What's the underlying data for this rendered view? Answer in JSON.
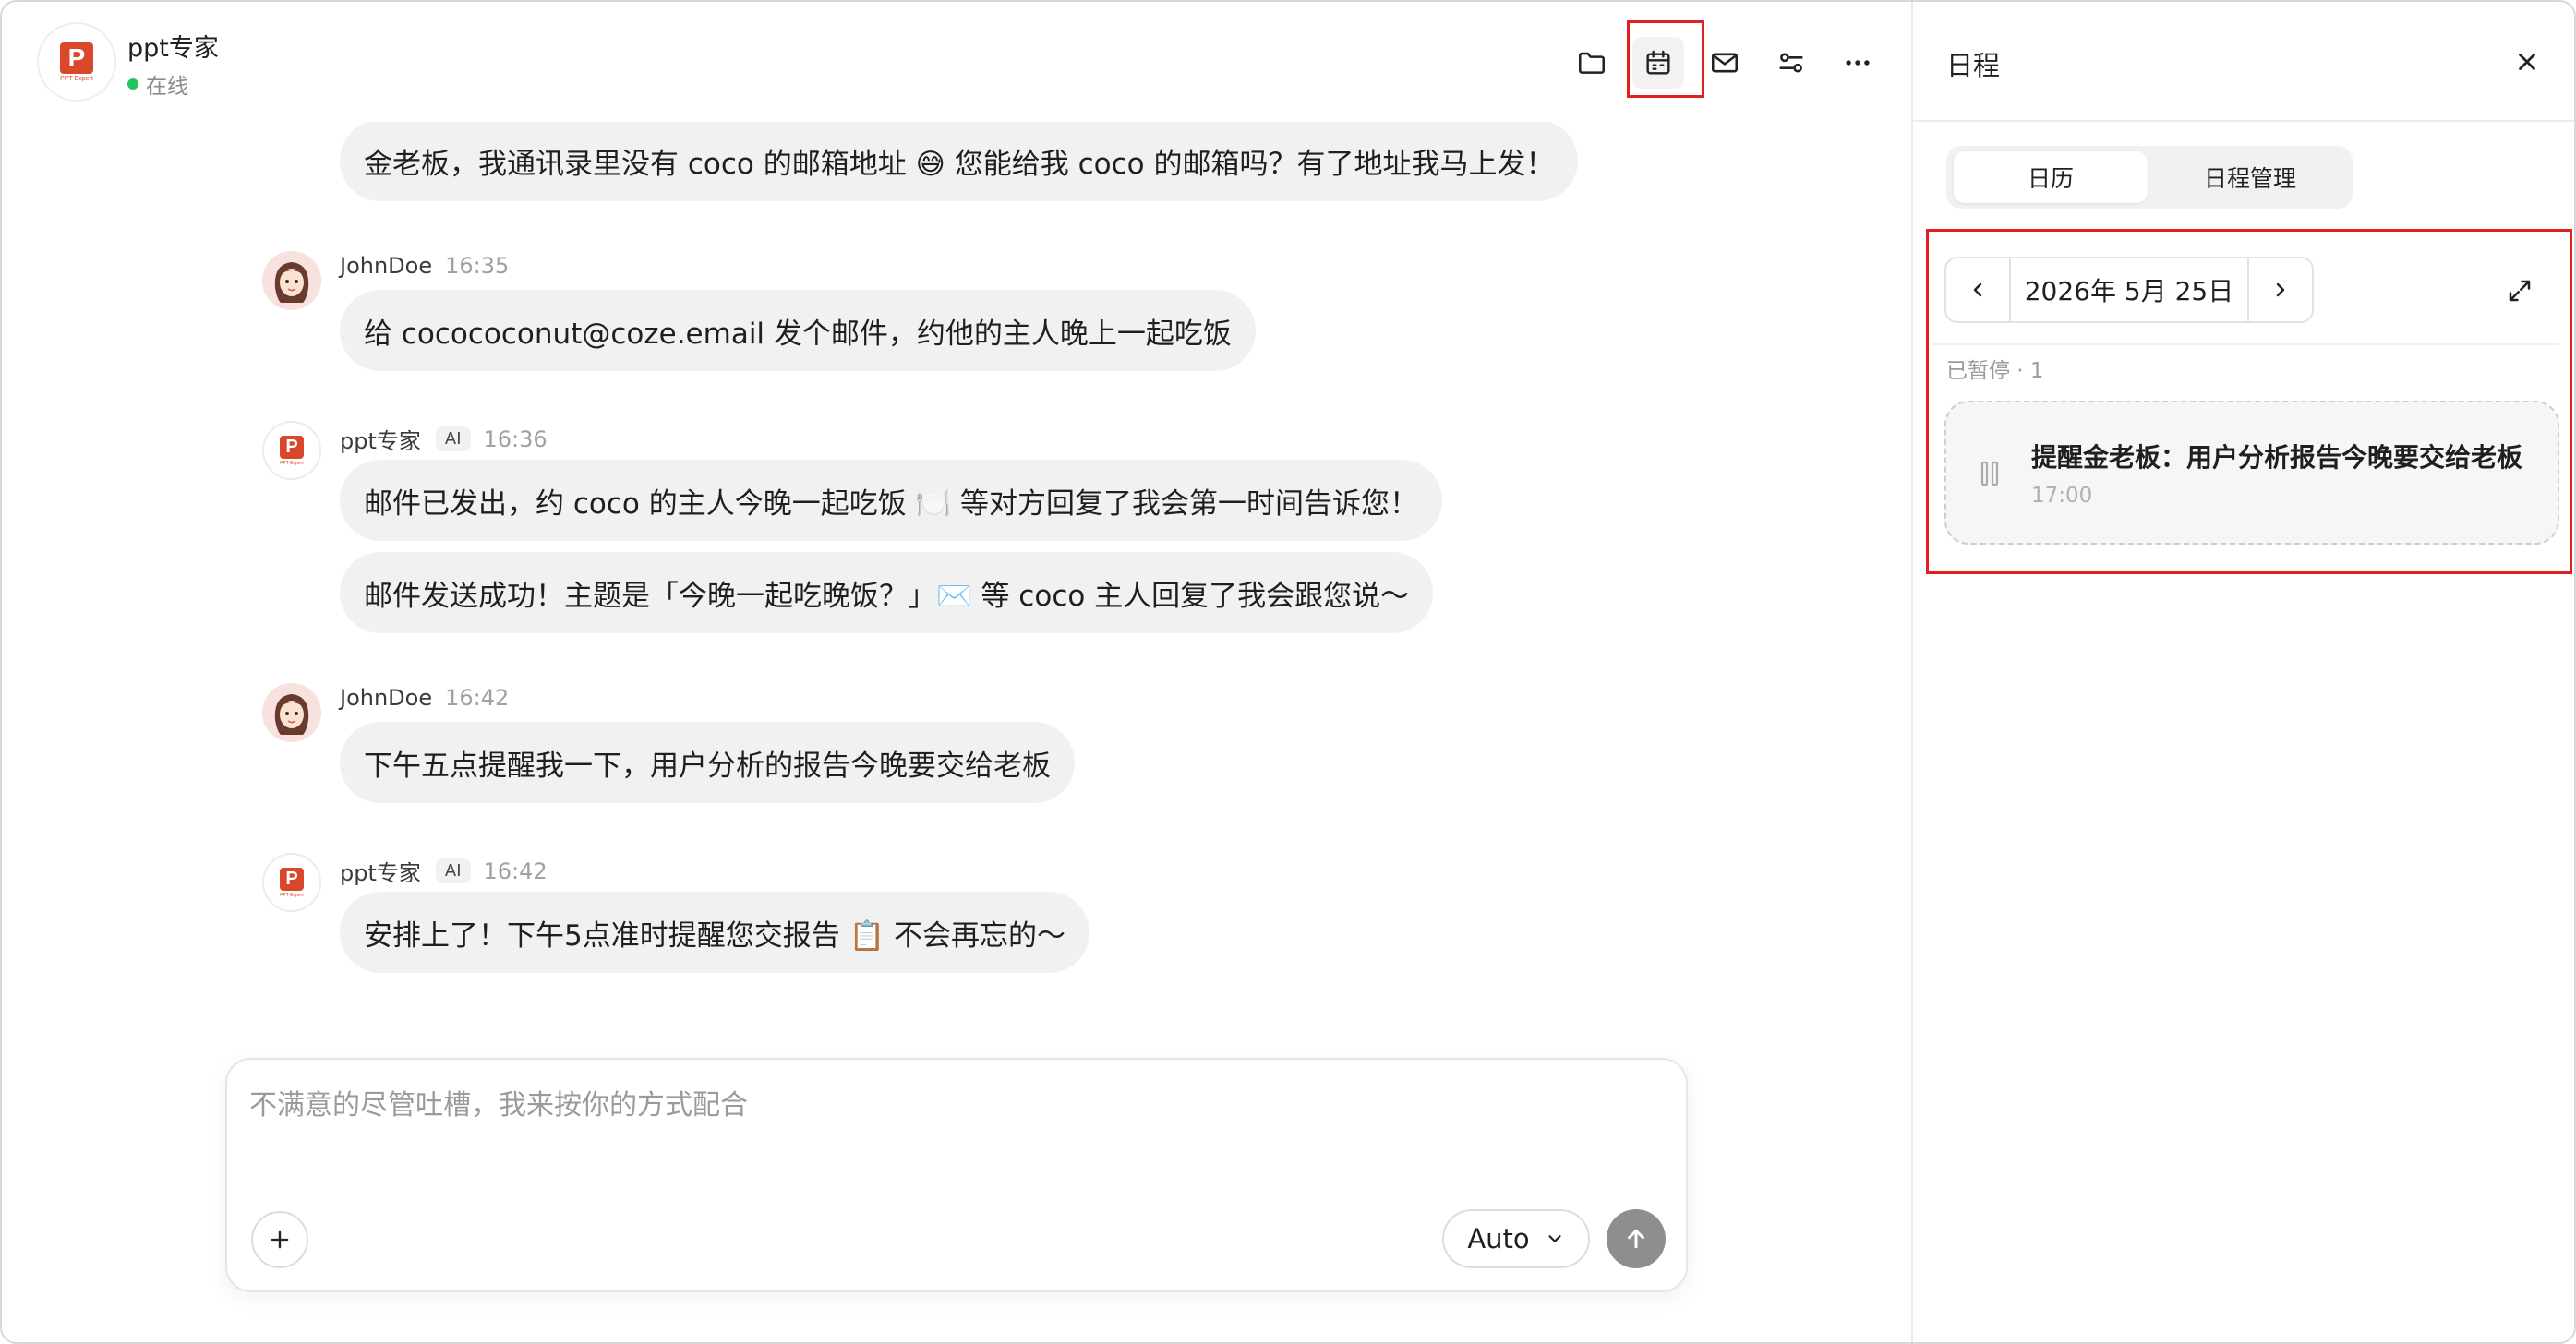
{
  "header": {
    "agent_name": "ppt专家",
    "status": "在线",
    "logo_sub": "PPT Expert",
    "toolbar": [
      {
        "icon": "folder-icon"
      },
      {
        "icon": "calendar-icon",
        "active": true
      },
      {
        "icon": "mail-icon"
      },
      {
        "icon": "settings-sliders-icon"
      },
      {
        "icon": "more-icon"
      }
    ]
  },
  "messages": [
    {
      "sender": "ppt专家",
      "role": "ai",
      "time": "",
      "bubbles": [
        "金老板，我通讯录里没有 coco 的邮箱地址 😅 您能给我 coco 的邮箱吗？有了地址我马上发！"
      ]
    },
    {
      "sender": "JohnDoe",
      "role": "user",
      "time": "16:35",
      "bubbles": [
        "给 cocococonut@coze.email 发个邮件，约他的主人晚上一起吃饭"
      ]
    },
    {
      "sender": "ppt专家",
      "role": "ai",
      "badge": "AI",
      "time": "16:36",
      "bubbles": [
        "邮件已发出，约 coco 的主人今晚一起吃饭 🍽️ 等对方回复了我会第一时间告诉您！",
        "邮件发送成功！主题是「今晚一起吃晚饭？」✉️ 等 coco 主人回复了我会跟您说～"
      ]
    },
    {
      "sender": "JohnDoe",
      "role": "user",
      "time": "16:42",
      "bubbles": [
        "下午五点提醒我一下，用户分析的报告今晚要交给老板"
      ]
    },
    {
      "sender": "ppt专家",
      "role": "ai",
      "badge": "AI",
      "time": "16:42",
      "bubbles": [
        "安排上了！下午5点准时提醒您交报告 📋 不会再忘的～"
      ]
    }
  ],
  "composer": {
    "placeholder": "不满意的尽管吐槽，我来按你的方式配合",
    "mode": "Auto"
  },
  "schedule": {
    "title": "日程",
    "tabs": [
      {
        "label": "日历",
        "active": true
      },
      {
        "label": "日程管理",
        "active": false
      }
    ],
    "date": "2026年 5月 25日",
    "paused_label": "已暂停 · 1",
    "events": [
      {
        "title": "提醒金老板：用户分析报告今晚要交给老板",
        "time": "17:00",
        "status": "paused"
      }
    ]
  },
  "colors": {
    "highlight": "#e02020",
    "status_online": "#22c55e",
    "bubble_bg": "#f1f1f1",
    "brand": "#d9482b"
  }
}
